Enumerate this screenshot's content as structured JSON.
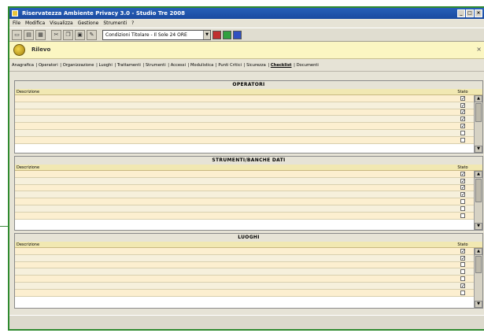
{
  "window": {
    "title": "Riservatezza Ambiente Privacy 3.0 - Studio Tre 2008"
  },
  "menu": [
    "File",
    "Modifica",
    "Visualizza",
    "Gestione",
    "Strumenti",
    "?"
  ],
  "toolbar": {
    "combo_value": "Condizioni Titolare - Il Sole 24 ORE"
  },
  "header": {
    "title": "Rilevo"
  },
  "tabs": [
    {
      "label": "Anagrafica"
    },
    {
      "label": "Operatori"
    },
    {
      "label": "Organizzazione"
    },
    {
      "label": "Luoghi"
    },
    {
      "label": "Trattamenti"
    },
    {
      "label": "Strumenti"
    },
    {
      "label": "Accessi"
    },
    {
      "label": "Modulistica"
    },
    {
      "label": "Punti Critici"
    },
    {
      "label": "Sicurezza"
    },
    {
      "label": "Checklist",
      "active": true
    },
    {
      "label": "Documenti"
    }
  ],
  "table_headers": {
    "description": "Descrizione",
    "status": "Stato"
  },
  "sections": {
    "operatori": {
      "title": "OPERATORI",
      "rows": [
        {
          "text": "",
          "checked": true
        },
        {
          "text": "",
          "checked": true
        },
        {
          "text": "",
          "checked": true
        },
        {
          "text": "",
          "checked": true
        },
        {
          "text": "",
          "checked": true
        },
        {
          "text": "",
          "checked": false
        },
        {
          "text": "",
          "checked": false
        }
      ]
    },
    "strumenti": {
      "title": "STRUMENTI/BANCHE DATI",
      "rows": [
        {
          "text": "",
          "checked": true
        },
        {
          "text": "",
          "checked": true
        },
        {
          "text": "",
          "checked": true
        },
        {
          "text": "",
          "checked": true
        },
        {
          "text": "",
          "checked": false
        },
        {
          "text": "",
          "checked": false
        },
        {
          "text": "",
          "checked": false
        }
      ]
    },
    "luoghi": {
      "title": "LUOGHI",
      "rows": [
        {
          "text": "",
          "checked": true
        },
        {
          "text": "",
          "checked": true
        },
        {
          "text": "",
          "checked": false
        },
        {
          "text": "",
          "checked": false
        },
        {
          "text": "",
          "checked": false
        },
        {
          "text": "",
          "checked": true
        },
        {
          "text": "",
          "checked": false
        }
      ]
    }
  }
}
